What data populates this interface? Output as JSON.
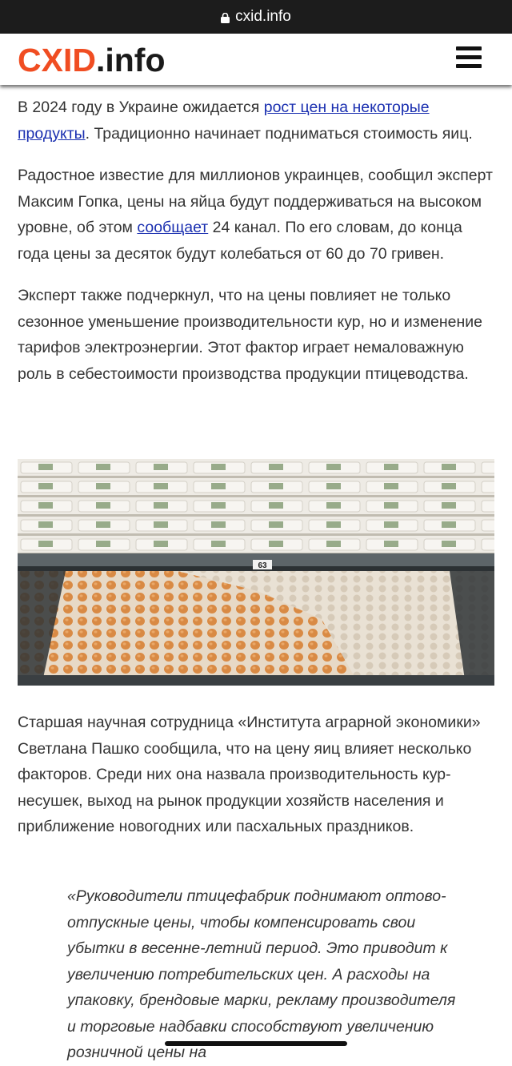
{
  "browser": {
    "url": "cxid.info"
  },
  "header": {
    "logo_part1": "CXID",
    "logo_part2": ".info"
  },
  "article": {
    "p1_before": "В 2024 году в Украине ожидается ",
    "p1_link": "рост цен на некоторые продукты",
    "p1_after": ". Традиционно начинает подниматься стоимость яиц.",
    "p2_before": "Радостное известие для миллионов украинцев, сообщил эксперт Максим Гопка, цены на яйца будут поддерживаться на высоком уровне, об этом ",
    "p2_link": "сообщает",
    "p2_after": " 24 канал. По его словам, до конца года цены за десяток будут колебаться от 60 до 70 гривен.",
    "p3": "Эксперт также подчеркнул, что на цены повлияет не только сезонное уменьшение производительности кур, но и изменение тарифов электроэнергии. Этот фактор играет немаловажную роль в себестоимости производства продукции птицеводства.",
    "price_tag": "63",
    "p4": "Старшая научная сотрудница «Института аграрной экономики» Светлана Пашко сообщила, что на цену яиц влияет несколько факторов. Среди них она назвала производительность кур-несушек, выход на рынок продукции хозяйств населения и приближение новогодних или пасхальных праздников.",
    "quote": "«Руководители птицефабрик поднимают оптово-отпускные цены, чтобы компенсировать свои убытки в весенне-летний период. Это приводит к увеличению потребительских цен. А расходы на упаковку, брендовые марки, рекламу производителя и торговые надбавки способствуют увеличению розничной цены на"
  },
  "colors": {
    "logo_accent": "#f04d22",
    "link": "#1a2fb0",
    "url_bar": "#1c1c1c"
  },
  "icons": [
    "lock-icon",
    "hamburger-menu-icon"
  ]
}
